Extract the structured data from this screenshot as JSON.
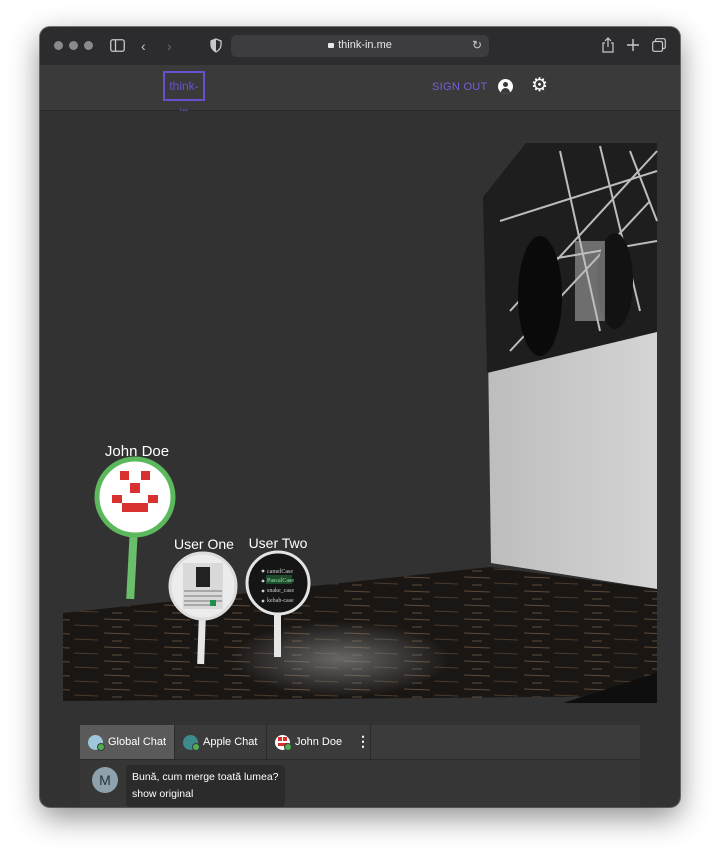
{
  "browser": {
    "url": "think-in.me",
    "icons": [
      "sidebar-icon",
      "back-icon",
      "forward-icon",
      "shield-icon",
      "lock-icon",
      "reload-icon",
      "share-icon",
      "new-tab-icon",
      "tabs-overview-icon"
    ]
  },
  "app": {
    "logo": "think-in",
    "sign_out": "SIGN OUT",
    "accent": "#6a4fcf"
  },
  "scene": {
    "avatars": [
      {
        "name": "John Doe",
        "ring_color": "#5cb85c"
      },
      {
        "name": "User One",
        "ring_color": "#e0e0e0"
      },
      {
        "name": "User Two",
        "ring_color": "#e0e0e0"
      }
    ],
    "user_two_card": [
      "camelCase",
      "PascalCase",
      "snake_case",
      "kebab-case"
    ]
  },
  "chat": {
    "tabs": [
      {
        "label": "Global Chat",
        "active": true
      },
      {
        "label": "Apple Chat",
        "active": false
      },
      {
        "label": "John Doe",
        "active": false
      }
    ],
    "message": {
      "avatar_letter": "M",
      "text": "Bună, cum merge toată lumea?",
      "action": "show original"
    }
  }
}
